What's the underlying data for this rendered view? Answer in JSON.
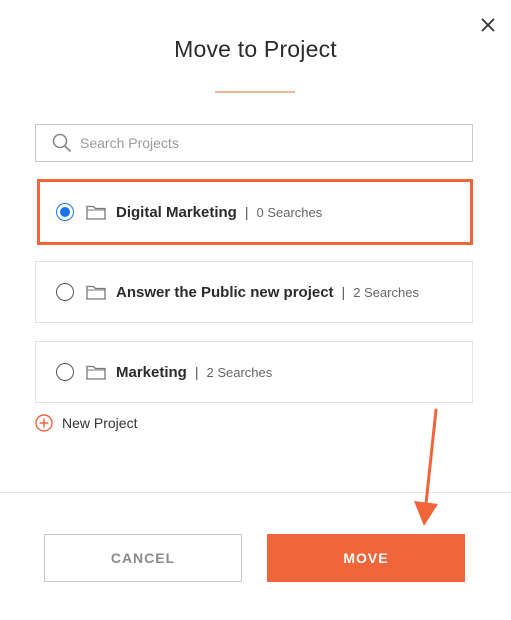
{
  "dialog": {
    "title": "Move to Project",
    "close_icon": "close-icon"
  },
  "search": {
    "placeholder": "Search Projects",
    "icon": "search-icon"
  },
  "projects": [
    {
      "name": "Digital Marketing",
      "separator": "|",
      "count": "0 Searches",
      "selected": true
    },
    {
      "name": "Answer the Public new project",
      "separator": "|",
      "count": "2 Searches",
      "selected": false
    },
    {
      "name": "Marketing",
      "separator": "|",
      "count": "2 Searches",
      "selected": false
    }
  ],
  "new_project": {
    "label": "New Project",
    "icon": "plus-circle-icon"
  },
  "buttons": {
    "cancel": "CANCEL",
    "move": "MOVE"
  },
  "colors": {
    "accent": "#f0653a",
    "radio_selected": "#1a73e8",
    "border": "#e2e2e2"
  }
}
